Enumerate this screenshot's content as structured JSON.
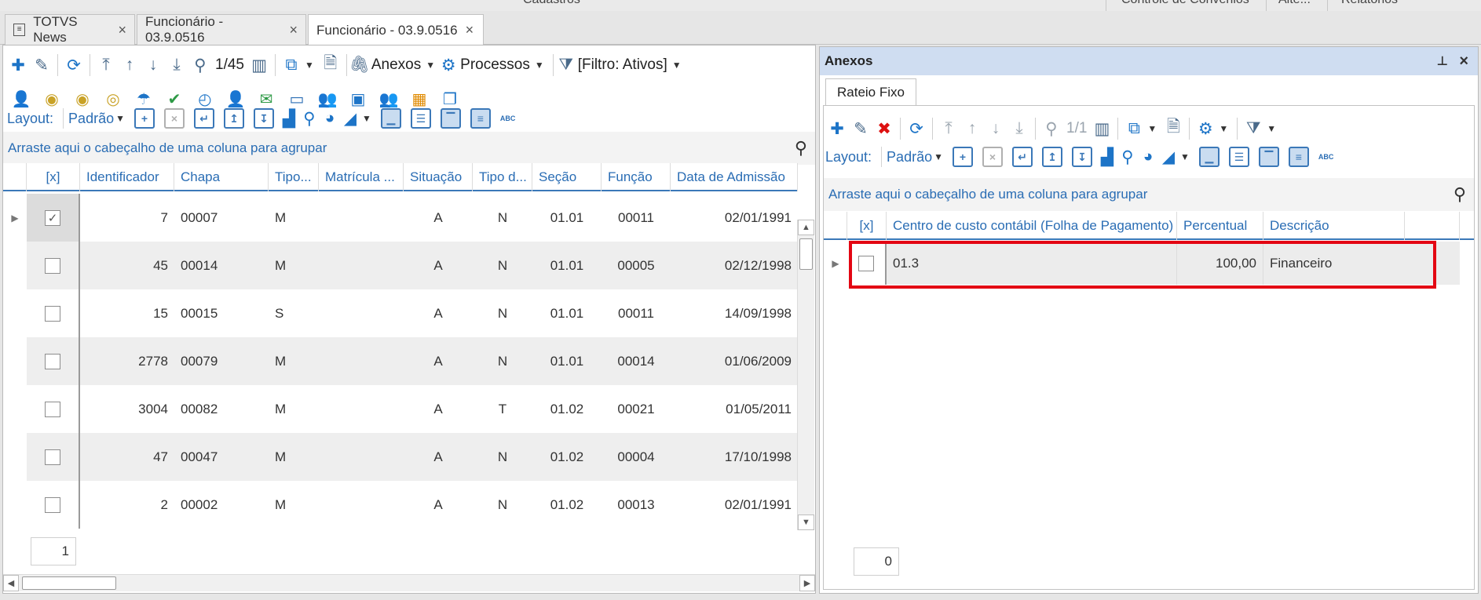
{
  "ribbon": {
    "center_label": "Cadastros",
    "right_labels": [
      "Controle de Convênios",
      "Alte...",
      "Relatórios"
    ]
  },
  "doc_tabs": [
    {
      "label": "TOTVS News",
      "icon": "news-icon"
    },
    {
      "label": "Funcionário - 03.9.0516"
    },
    {
      "label": "Funcionário - 03.9.0516",
      "active": true
    }
  ],
  "left": {
    "toolbar": {
      "record_position": "1/45",
      "anexos_label": "Anexos",
      "processos_label": "Processos",
      "filter_label": "[Filtro: Ativos]"
    },
    "layout": {
      "label": "Layout:",
      "preset": "Padrão",
      "abc": "ABC"
    },
    "group_hint": "Arraste aqui o cabeçalho de uma coluna para agrupar",
    "columns": [
      "[x]",
      "Identificador",
      "Chapa",
      "Tipo...",
      "Matrícula ...",
      "Situação",
      "Tipo d...",
      "Seção",
      "Função",
      "Data de Admissão"
    ],
    "rows": [
      {
        "checked": true,
        "id": "7",
        "chapa": "00007",
        "tipo": "M",
        "matricula": "",
        "situacao": "A",
        "tipod": "N",
        "secao": "01.01",
        "funcao": "00011",
        "admissao": "02/01/1991"
      },
      {
        "checked": false,
        "id": "45",
        "chapa": "00014",
        "tipo": "M",
        "matricula": "",
        "situacao": "A",
        "tipod": "N",
        "secao": "01.01",
        "funcao": "00005",
        "admissao": "02/12/1998"
      },
      {
        "checked": false,
        "id": "15",
        "chapa": "00015",
        "tipo": "S",
        "matricula": "",
        "situacao": "A",
        "tipod": "N",
        "secao": "01.01",
        "funcao": "00011",
        "admissao": "14/09/1998"
      },
      {
        "checked": false,
        "id": "2778",
        "chapa": "00079",
        "tipo": "M",
        "matricula": "",
        "situacao": "A",
        "tipod": "N",
        "secao": "01.01",
        "funcao": "00014",
        "admissao": "01/06/2009"
      },
      {
        "checked": false,
        "id": "3004",
        "chapa": "00082",
        "tipo": "M",
        "matricula": "",
        "situacao": "A",
        "tipod": "T",
        "secao": "01.02",
        "funcao": "00021",
        "admissao": "01/05/2011"
      },
      {
        "checked": false,
        "id": "47",
        "chapa": "00047",
        "tipo": "M",
        "matricula": "",
        "situacao": "A",
        "tipod": "N",
        "secao": "01.02",
        "funcao": "00004",
        "admissao": "17/10/1998"
      },
      {
        "checked": false,
        "id": "2",
        "chapa": "00002",
        "tipo": "M",
        "matricula": "",
        "situacao": "A",
        "tipod": "N",
        "secao": "01.02",
        "funcao": "00013",
        "admissao": "02/01/1991"
      }
    ],
    "footer_count": "1"
  },
  "right": {
    "title": "Anexos",
    "subtab": "Rateio Fixo",
    "toolbar": {
      "record_position": "1/1"
    },
    "layout": {
      "label": "Layout:",
      "preset": "Padrão",
      "abc": "ABC"
    },
    "group_hint": "Arraste aqui o cabeçalho de uma coluna para agrupar",
    "columns": [
      "[x]",
      "Centro de custo contábil (Folha de Pagamento)",
      "Percentual",
      "Descrição"
    ],
    "rows": [
      {
        "checked": false,
        "centro": "01.3",
        "percentual": "100,00",
        "descricao": "Financeiro"
      }
    ],
    "footer_count": "0"
  },
  "colors": {
    "accent": "#3b78b8",
    "highlight": "#e30613",
    "panel_header": "#cfddf1"
  }
}
